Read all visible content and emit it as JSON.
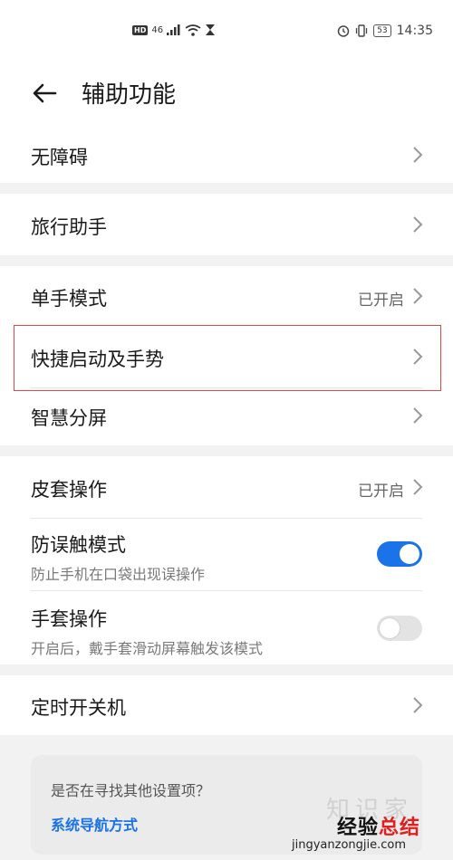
{
  "status_bar": {
    "hd": "HD",
    "signal_tag": "46",
    "time": "14:35",
    "battery": "53"
  },
  "header": {
    "title": "辅助功能"
  },
  "items": {
    "accessibility": {
      "label": "无障碍"
    },
    "travel": {
      "label": "旅行助手"
    },
    "one_hand": {
      "label": "单手模式",
      "value": "已开启"
    },
    "shortcuts": {
      "label": "快捷启动及手势"
    },
    "split_screen": {
      "label": "智慧分屏"
    },
    "cover": {
      "label": "皮套操作",
      "value": "已开启"
    },
    "pocket": {
      "label": "防误触模式",
      "subtitle": "防止手机在口袋出现误操作",
      "enabled": true
    },
    "glove": {
      "label": "手套操作",
      "subtitle": "开启后，戴手套滑动屏幕触发该模式",
      "enabled": false
    },
    "power_schedule": {
      "label": "定时开关机"
    }
  },
  "suggest": {
    "question": "是否在寻找其他设置项？",
    "link": "系统导航方式"
  },
  "watermark": {
    "part1": "经验",
    "part2": "总结",
    "url": "jingyanzongjie.com",
    "faint": "知识家"
  },
  "colors": {
    "accent": "#1a73e8",
    "highlight": "#e04848"
  }
}
